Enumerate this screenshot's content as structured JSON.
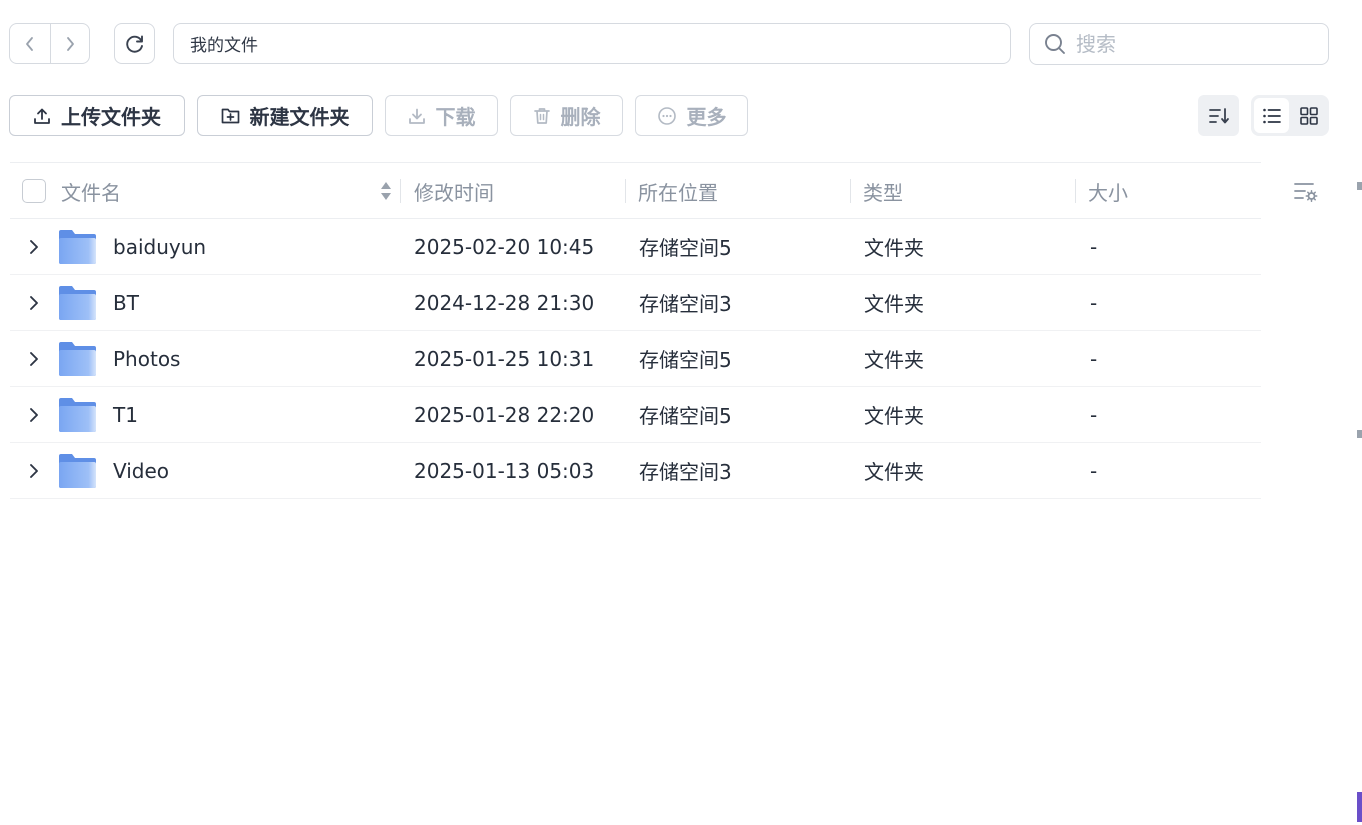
{
  "nav": {
    "back_icon": "chevron-left-icon",
    "forward_icon": "chevron-right-icon",
    "refresh_icon": "refresh-icon"
  },
  "path": {
    "current": "我的文件"
  },
  "search": {
    "placeholder": "搜索",
    "value": ""
  },
  "toolbar": {
    "upload_folder": "上传文件夹",
    "new_folder": "新建文件夹",
    "download": "下载",
    "delete": "删除",
    "more": "更多"
  },
  "view": {
    "mode": "list"
  },
  "columns": {
    "name": "文件名",
    "modified": "修改时间",
    "location": "所在位置",
    "type": "类型",
    "size": "大小"
  },
  "rows": [
    {
      "name": "baiduyun",
      "modified": "2025-02-20 10:45",
      "location": "存储空间5",
      "type": "文件夹",
      "size": "-"
    },
    {
      "name": "BT",
      "modified": "2024-12-28 21:30",
      "location": "存储空间3",
      "type": "文件夹",
      "size": "-"
    },
    {
      "name": "Photos",
      "modified": "2025-01-25 10:31",
      "location": "存储空间5",
      "type": "文件夹",
      "size": "-"
    },
    {
      "name": "T1",
      "modified": "2025-01-28 22:20",
      "location": "存储空间5",
      "type": "文件夹",
      "size": "-"
    },
    {
      "name": "Video",
      "modified": "2025-01-13 05:03",
      "location": "存储空间3",
      "type": "文件夹",
      "size": "-"
    }
  ],
  "colors": {
    "folder": "#6f9ef0",
    "folder_light": "#9ec0f7",
    "border": "#d6dae0",
    "muted_text": "#8a93a0"
  }
}
